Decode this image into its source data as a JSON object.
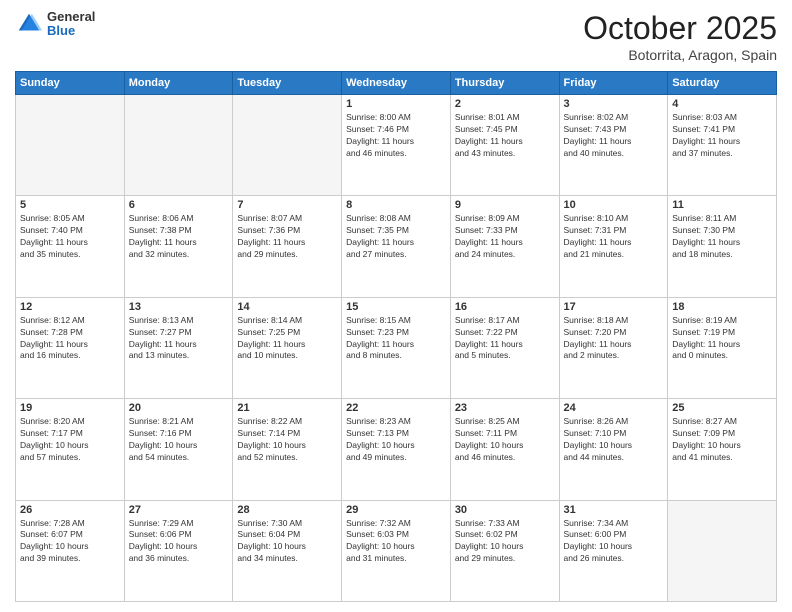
{
  "header": {
    "logo_general": "General",
    "logo_blue": "Blue",
    "title": "October 2025",
    "location": "Botorrita, Aragon, Spain"
  },
  "days_of_week": [
    "Sunday",
    "Monday",
    "Tuesday",
    "Wednesday",
    "Thursday",
    "Friday",
    "Saturday"
  ],
  "weeks": [
    [
      {
        "day": "",
        "info": ""
      },
      {
        "day": "",
        "info": ""
      },
      {
        "day": "",
        "info": ""
      },
      {
        "day": "1",
        "info": "Sunrise: 8:00 AM\nSunset: 7:46 PM\nDaylight: 11 hours\nand 46 minutes."
      },
      {
        "day": "2",
        "info": "Sunrise: 8:01 AM\nSunset: 7:45 PM\nDaylight: 11 hours\nand 43 minutes."
      },
      {
        "day": "3",
        "info": "Sunrise: 8:02 AM\nSunset: 7:43 PM\nDaylight: 11 hours\nand 40 minutes."
      },
      {
        "day": "4",
        "info": "Sunrise: 8:03 AM\nSunset: 7:41 PM\nDaylight: 11 hours\nand 37 minutes."
      }
    ],
    [
      {
        "day": "5",
        "info": "Sunrise: 8:05 AM\nSunset: 7:40 PM\nDaylight: 11 hours\nand 35 minutes."
      },
      {
        "day": "6",
        "info": "Sunrise: 8:06 AM\nSunset: 7:38 PM\nDaylight: 11 hours\nand 32 minutes."
      },
      {
        "day": "7",
        "info": "Sunrise: 8:07 AM\nSunset: 7:36 PM\nDaylight: 11 hours\nand 29 minutes."
      },
      {
        "day": "8",
        "info": "Sunrise: 8:08 AM\nSunset: 7:35 PM\nDaylight: 11 hours\nand 27 minutes."
      },
      {
        "day": "9",
        "info": "Sunrise: 8:09 AM\nSunset: 7:33 PM\nDaylight: 11 hours\nand 24 minutes."
      },
      {
        "day": "10",
        "info": "Sunrise: 8:10 AM\nSunset: 7:31 PM\nDaylight: 11 hours\nand 21 minutes."
      },
      {
        "day": "11",
        "info": "Sunrise: 8:11 AM\nSunset: 7:30 PM\nDaylight: 11 hours\nand 18 minutes."
      }
    ],
    [
      {
        "day": "12",
        "info": "Sunrise: 8:12 AM\nSunset: 7:28 PM\nDaylight: 11 hours\nand 16 minutes."
      },
      {
        "day": "13",
        "info": "Sunrise: 8:13 AM\nSunset: 7:27 PM\nDaylight: 11 hours\nand 13 minutes."
      },
      {
        "day": "14",
        "info": "Sunrise: 8:14 AM\nSunset: 7:25 PM\nDaylight: 11 hours\nand 10 minutes."
      },
      {
        "day": "15",
        "info": "Sunrise: 8:15 AM\nSunset: 7:23 PM\nDaylight: 11 hours\nand 8 minutes."
      },
      {
        "day": "16",
        "info": "Sunrise: 8:17 AM\nSunset: 7:22 PM\nDaylight: 11 hours\nand 5 minutes."
      },
      {
        "day": "17",
        "info": "Sunrise: 8:18 AM\nSunset: 7:20 PM\nDaylight: 11 hours\nand 2 minutes."
      },
      {
        "day": "18",
        "info": "Sunrise: 8:19 AM\nSunset: 7:19 PM\nDaylight: 11 hours\nand 0 minutes."
      }
    ],
    [
      {
        "day": "19",
        "info": "Sunrise: 8:20 AM\nSunset: 7:17 PM\nDaylight: 10 hours\nand 57 minutes."
      },
      {
        "day": "20",
        "info": "Sunrise: 8:21 AM\nSunset: 7:16 PM\nDaylight: 10 hours\nand 54 minutes."
      },
      {
        "day": "21",
        "info": "Sunrise: 8:22 AM\nSunset: 7:14 PM\nDaylight: 10 hours\nand 52 minutes."
      },
      {
        "day": "22",
        "info": "Sunrise: 8:23 AM\nSunset: 7:13 PM\nDaylight: 10 hours\nand 49 minutes."
      },
      {
        "day": "23",
        "info": "Sunrise: 8:25 AM\nSunset: 7:11 PM\nDaylight: 10 hours\nand 46 minutes."
      },
      {
        "day": "24",
        "info": "Sunrise: 8:26 AM\nSunset: 7:10 PM\nDaylight: 10 hours\nand 44 minutes."
      },
      {
        "day": "25",
        "info": "Sunrise: 8:27 AM\nSunset: 7:09 PM\nDaylight: 10 hours\nand 41 minutes."
      }
    ],
    [
      {
        "day": "26",
        "info": "Sunrise: 7:28 AM\nSunset: 6:07 PM\nDaylight: 10 hours\nand 39 minutes."
      },
      {
        "day": "27",
        "info": "Sunrise: 7:29 AM\nSunset: 6:06 PM\nDaylight: 10 hours\nand 36 minutes."
      },
      {
        "day": "28",
        "info": "Sunrise: 7:30 AM\nSunset: 6:04 PM\nDaylight: 10 hours\nand 34 minutes."
      },
      {
        "day": "29",
        "info": "Sunrise: 7:32 AM\nSunset: 6:03 PM\nDaylight: 10 hours\nand 31 minutes."
      },
      {
        "day": "30",
        "info": "Sunrise: 7:33 AM\nSunset: 6:02 PM\nDaylight: 10 hours\nand 29 minutes."
      },
      {
        "day": "31",
        "info": "Sunrise: 7:34 AM\nSunset: 6:00 PM\nDaylight: 10 hours\nand 26 minutes."
      },
      {
        "day": "",
        "info": ""
      }
    ]
  ]
}
